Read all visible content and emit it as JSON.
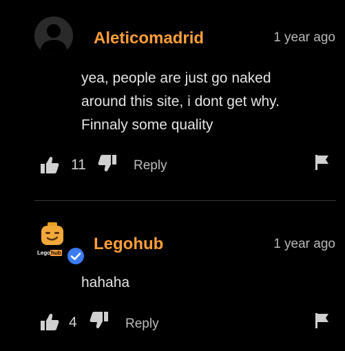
{
  "comments": [
    {
      "username": "Aleticomadrid",
      "timestamp": "1 year ago",
      "body_lines": [
        "yea, people are just go naked",
        "around this site, i dont get why.",
        "Finnaly some quality"
      ],
      "likes": "11",
      "reply_label": "Reply"
    },
    {
      "username": "Legohub",
      "timestamp": "1 year ago",
      "body_lines": [
        "hahaha"
      ],
      "likes": "4",
      "reply_label": "Reply",
      "logo_prefix": "Lego",
      "logo_suffix": "hub"
    }
  ],
  "colors": {
    "background": "#000000",
    "username": "#ff9f3a",
    "verified": "#3b7cf4",
    "text": "#e4e4e4"
  },
  "icons": {
    "like": "thumbs-up-icon",
    "dislike": "thumbs-down-icon",
    "flag": "flag-icon",
    "verified": "check-icon",
    "avatar_default": "user-silhouette-icon"
  }
}
